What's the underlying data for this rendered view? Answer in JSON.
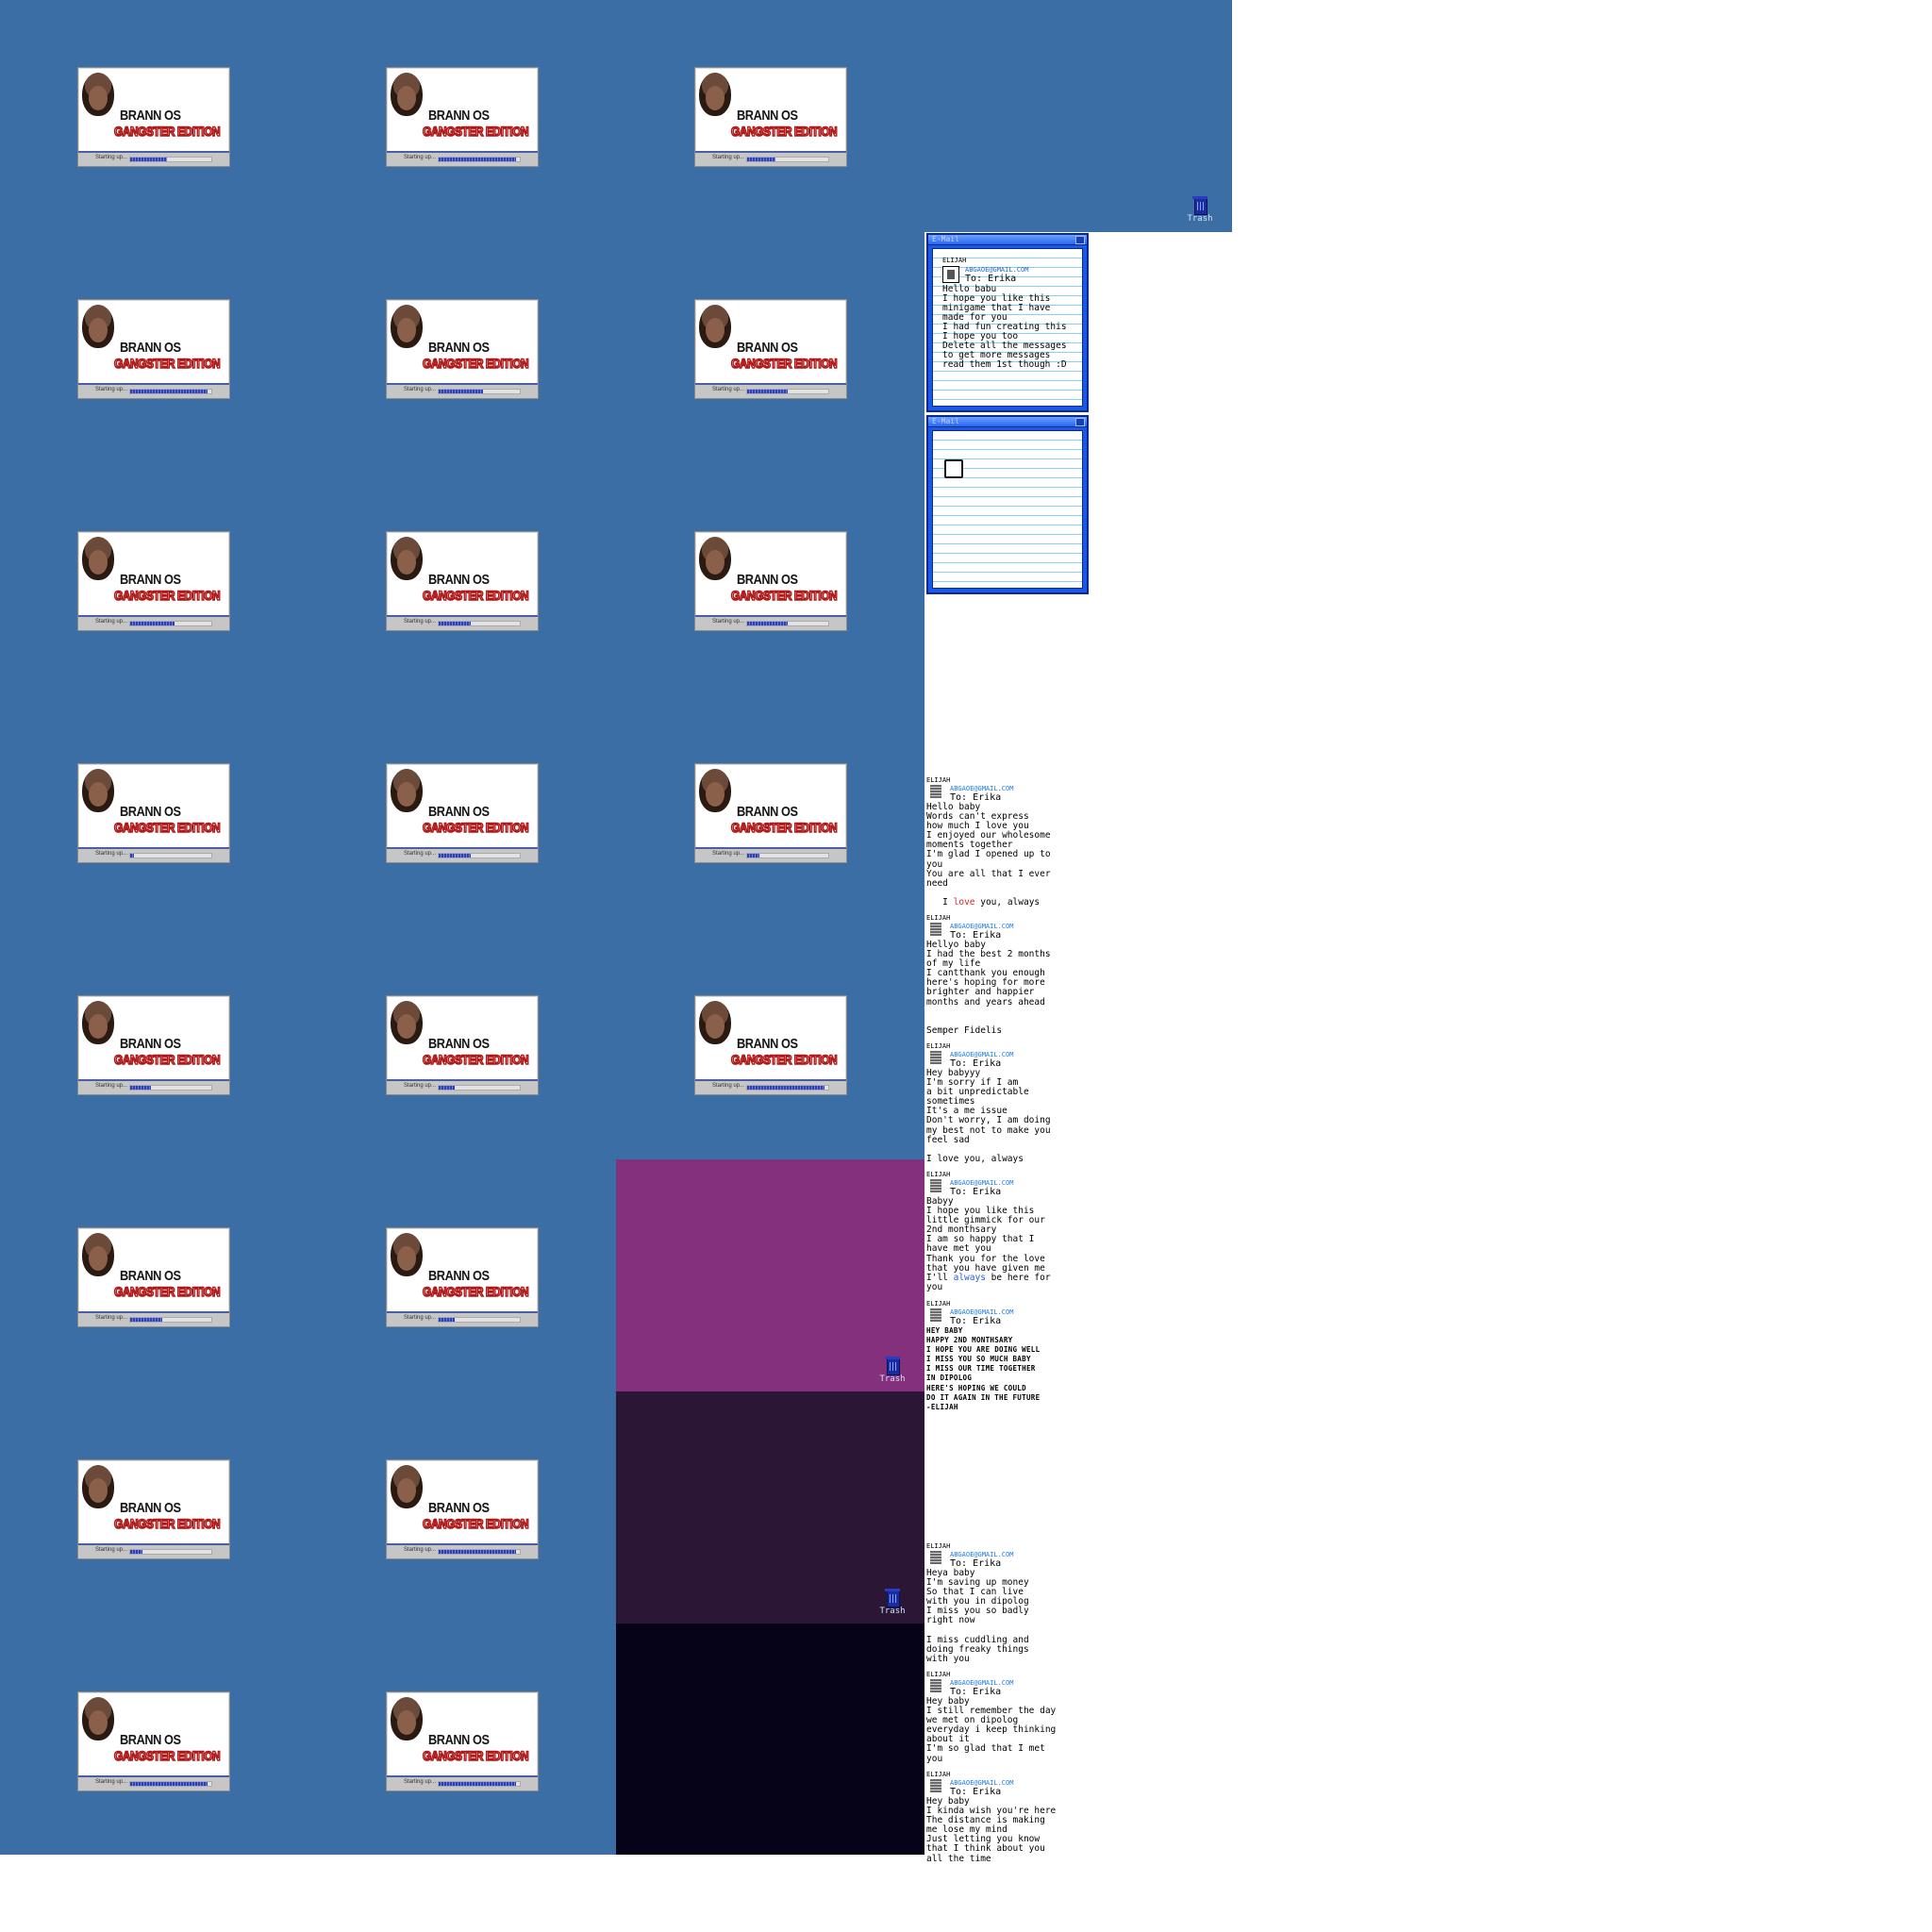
{
  "boot_screen": {
    "title": "BRANN OS",
    "subtitle": "GANGSTER EDITION",
    "status_label": "Starting up..."
  },
  "boot_progress": [
    0.45,
    0.95,
    0.35,
    0.95,
    0.55,
    0.5,
    0.55,
    0.4,
    0.5,
    0.05,
    0.4,
    0.15,
    0.25,
    0.2,
    0.95,
    0.4,
    0.2,
    0.15,
    0.95,
    0.95,
    0.95
  ],
  "trash": {
    "label": "Trash"
  },
  "windows": {
    "open_message": {
      "title": "E-Mail",
      "from": "ELIJAH",
      "email": "ABGAOE@GMAIL.COM",
      "to": "To: Erika",
      "body": "Hello babu\nI hope you like this\nminigame that I have\nmade for you\nI had fun creating this\nI hope you too\nDelete all the messages\nto get more messages\nread them 1st though :D"
    },
    "blank_message": {
      "title": "E-Mail"
    }
  },
  "messages": [
    {
      "from": "ELIJAH",
      "email": "ABGAOE@GMAIL.COM",
      "to": "To: Erika",
      "body_before": "Hello baby\nWords can't express\nhow much I love you\nI enjoyed our wholesome\nmoments together\nI'm glad I opened up to\nyou\nYou are all that I ever\nneed\n\n   I ",
      "highlight": "love",
      "body_after": " you, always"
    },
    {
      "from": "ELIJAH",
      "email": "ABGAOE@GMAIL.COM",
      "to": "To: Erika",
      "body": "Hellyo baby\nI had the best 2 months\nof my life\nI cantthank you enough\nhere's hoping for more\nbrighter and happier\nmonths and years ahead\n\n\nSemper Fidelis"
    },
    {
      "from": "ELIJAH",
      "email": "ABGAOE@GMAIL.COM",
      "to": "To: Erika",
      "body": "Hey babyyy\nI'm sorry if I am\na bit unpredictable\nsometimes\nIt's a me issue\nDon't worry, I am doing\nmy best not to make you\nfeel sad\n\nI love you, always"
    },
    {
      "from": "ELIJAH",
      "email": "ABGAOE@GMAIL.COM",
      "to": "To: Erika",
      "body_before": "Babyy\nI hope you like this\nlittle gimmick for our\n2nd monthsary\nI am so happy that I\nhave met you\nThank you for the love\nthat you have given me\nI'll ",
      "highlight": "always",
      "body_after": " be here for\nyou"
    },
    {
      "from": "ELIJAH",
      "email": "ABGAOE@GMAIL.COM",
      "to": "To: Erika",
      "body": "HEY BABY\nHAPPY 2ND MONTHSARY\nI HOPE YOU ARE DOING WELL\nI MISS YOU SO MUCH BABY\nI MISS OUR TIME TOGETHER\nIN DIPOLOG\nHERE'S HOPING WE COULD\nDO IT AGAIN IN THE FUTURE\n-ELIJAH"
    },
    {
      "from": "ELIJAH",
      "email": "ABGAOE@GMAIL.COM",
      "to": "To: Erika",
      "body": "Heya baby\nI'm saving up money\nSo that I can live\nwith you in dipolog\nI miss you so badly\nright now\n\nI miss cuddling and\ndoing freaky things\nwith you"
    },
    {
      "from": "ELIJAH",
      "email": "ABGAOE@GMAIL.COM",
      "to": "To: Erika",
      "body": "Hey baby\nI still remember the day\nwe met on dipolog\neveryday i keep thinking\nabout it\nI'm so glad that I met\nyou"
    },
    {
      "from": "ELIJAH",
      "email": "ABGAOE@GMAIL.COM",
      "to": "To: Erika",
      "body": "Hey baby\nI kinda wish you're here\nThe distance is making\nme lose my mind\nJust letting you know\nthat I think about you\nall the time"
    }
  ]
}
